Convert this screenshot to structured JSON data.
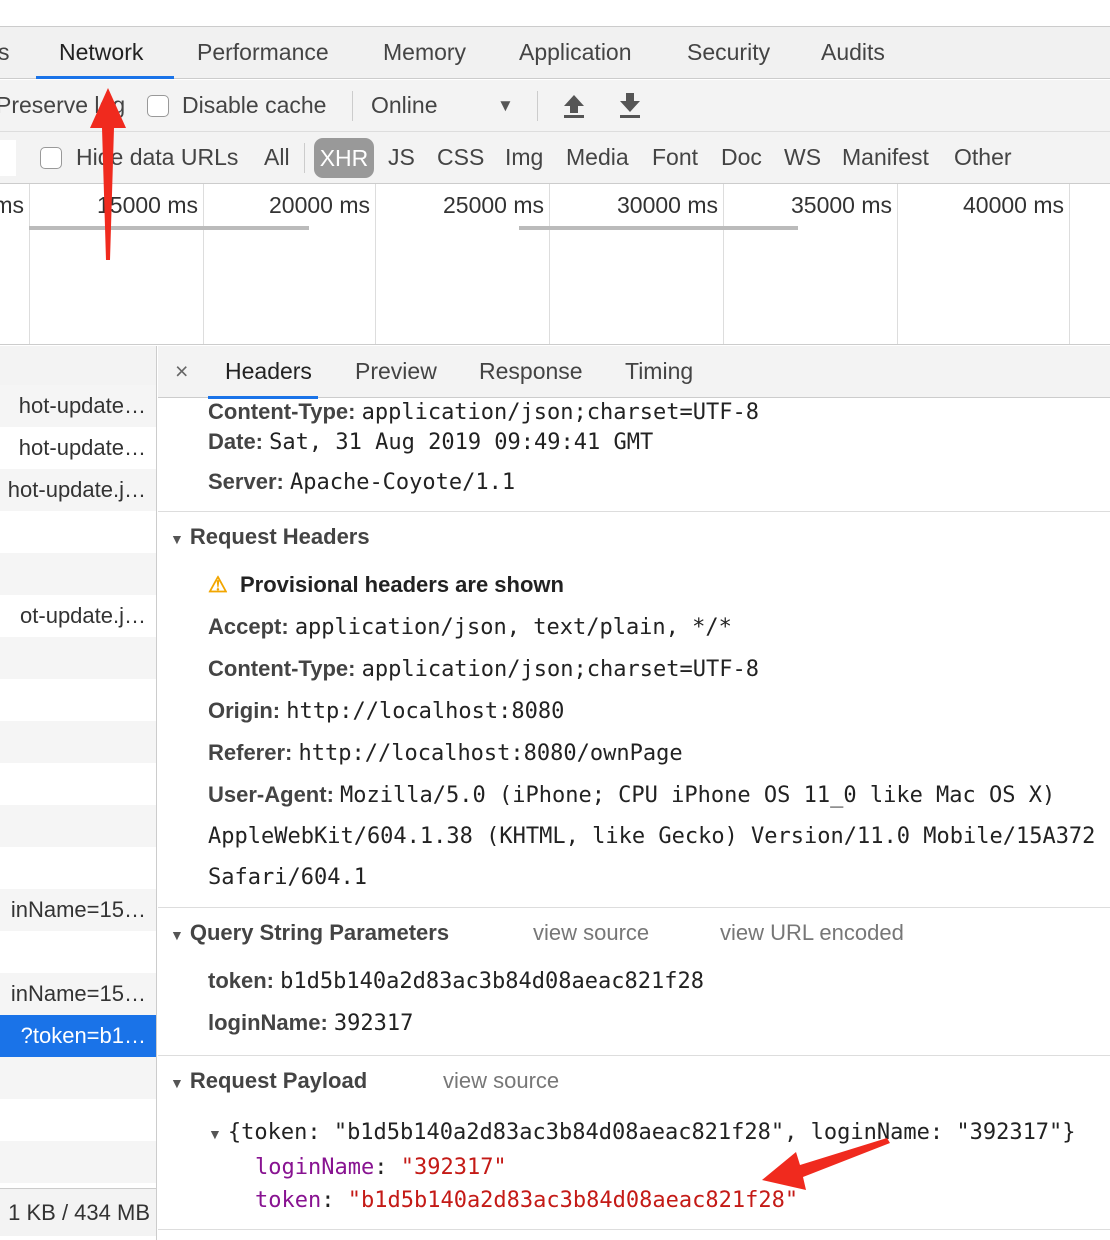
{
  "main_tabs": [
    "s",
    "Network",
    "Performance",
    "Memory",
    "Application",
    "Security",
    "Audits"
  ],
  "toolbar": {
    "preserve_log": "Preserve log",
    "disable_cache": "Disable cache",
    "throttle": "Online",
    "upload_icon": "import-har-icon",
    "download_icon": "export-har-icon"
  },
  "filter": {
    "hide_data_urls": "Hide data URLs",
    "types": [
      "All",
      "XHR",
      "JS",
      "CSS",
      "Img",
      "Media",
      "Font",
      "Doc",
      "WS",
      "Manifest",
      "Other"
    ],
    "active": "XHR"
  },
  "timeline": {
    "ticks": [
      "ms",
      "15000 ms",
      "20000 ms",
      "25000 ms",
      "30000 ms",
      "35000 ms",
      "40000 ms"
    ]
  },
  "requests": [
    {
      "name": "hot-update…"
    },
    {
      "name": "hot-update…"
    },
    {
      "name": "hot-update.j…"
    },
    {
      "name": ""
    },
    {
      "name": ""
    },
    {
      "name": "ot-update.j…"
    },
    {
      "name": ""
    },
    {
      "name": ""
    },
    {
      "name": ""
    },
    {
      "name": ""
    },
    {
      "name": ""
    },
    {
      "name": ""
    },
    {
      "name": "inName=15…"
    },
    {
      "name": ""
    },
    {
      "name": "inName=15…"
    },
    {
      "name": "?token=b1…",
      "selected": true
    },
    {
      "name": ""
    },
    {
      "name": ""
    },
    {
      "name": ""
    }
  ],
  "footer": "1 KB / 434 MB",
  "detail": {
    "close": "×",
    "tabs": [
      "Headers",
      "Preview",
      "Response",
      "Timing"
    ],
    "response_headers": [
      {
        "k": "Content-Type:",
        "v": "application/json;charset=UTF-8"
      },
      {
        "k": "Date:",
        "v": "Sat, 31 Aug 2019 09:49:41 GMT"
      },
      {
        "k": "Server:",
        "v": "Apache-Coyote/1.1"
      }
    ],
    "request_headers_title": "Request Headers",
    "provisional": "Provisional headers are shown",
    "request_headers": [
      {
        "k": "Accept:",
        "v": "application/json, text/plain, */*"
      },
      {
        "k": "Content-Type:",
        "v": "application/json;charset=UTF-8"
      },
      {
        "k": "Origin:",
        "v": "http://localhost:8080"
      },
      {
        "k": "Referer:",
        "v": "http://localhost:8080/ownPage"
      },
      {
        "k": "User-Agent:",
        "v": "Mozilla/5.0 (iPhone; CPU iPhone OS 11_0 like Mac OS X) AppleWebKit/604.1.38 (KHTML, like Gecko) Version/11.0 Mobile/15A372 Safari/604.1"
      }
    ],
    "ua_line2": "WebKit/604.1.38 (KHTML, like Gecko) Version/11.0 Mobile/15A372",
    "ua_line3": "04.1",
    "ua_line1": "Mozilla/5.0 (iPhone; CPU iPhone OS 11_0 like Mac OS X",
    "query_title": "Query String Parameters",
    "view_source": "view source",
    "view_url_encoded": "view URL encoded",
    "query": [
      {
        "k": "token:",
        "v": "b1d5b140a2d83ac3b84d08aeac821f28"
      },
      {
        "k": "loginName:",
        "v": "392317"
      }
    ],
    "payload_title": "Request Payload",
    "payload_summary": "{token: \"b1d5b140a2d83ac3b84d08aeac821f28\", loginName: \"392317\"}",
    "payload": [
      {
        "k": "loginName",
        "v": "\"392317\""
      },
      {
        "k": "token",
        "v": "\"b1d5b140a2d83ac3b84d08aeac821f28\""
      }
    ]
  }
}
